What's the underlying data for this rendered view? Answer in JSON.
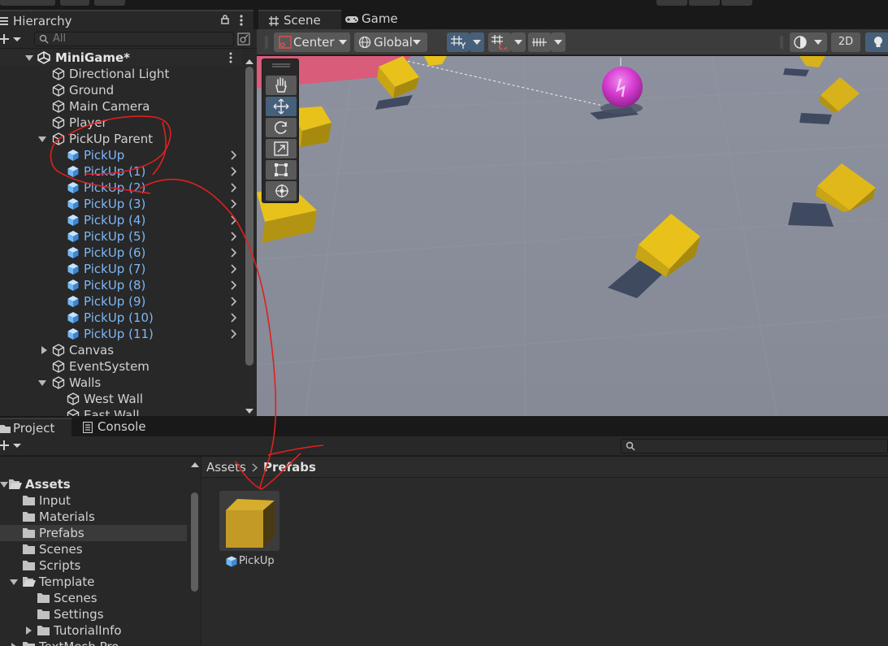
{
  "hierarchy": {
    "tab_label": "Hierarchy",
    "search_placeholder": "All",
    "scene_name": "MiniGame*",
    "items": [
      {
        "label": "Directional Light"
      },
      {
        "label": "Ground"
      },
      {
        "label": "Main Camera"
      },
      {
        "label": "Player"
      },
      {
        "label": "PickUp Parent"
      },
      {
        "label": "PickUp"
      },
      {
        "label": "PickUp (1)"
      },
      {
        "label": "PickUp (2)"
      },
      {
        "label": "PickUp (3)"
      },
      {
        "label": "PickUp (4)"
      },
      {
        "label": "PickUp (5)"
      },
      {
        "label": "PickUp (6)"
      },
      {
        "label": "PickUp (7)"
      },
      {
        "label": "PickUp (8)"
      },
      {
        "label": "PickUp (9)"
      },
      {
        "label": "PickUp (10)"
      },
      {
        "label": "PickUp (11)"
      },
      {
        "label": "Canvas"
      },
      {
        "label": "EventSystem"
      },
      {
        "label": "Walls"
      },
      {
        "label": "West Wall"
      },
      {
        "label": "East Wall"
      }
    ]
  },
  "scene": {
    "scene_tab": "Scene",
    "game_tab": "Game",
    "pivot_label": "Center",
    "space_label": "Global",
    "mode_2d": "2D"
  },
  "project": {
    "project_tab": "Project",
    "console_tab": "Console",
    "tree": [
      {
        "label": "Assets"
      },
      {
        "label": "Input"
      },
      {
        "label": "Materials"
      },
      {
        "label": "Prefabs"
      },
      {
        "label": "Scenes"
      },
      {
        "label": "Scripts"
      },
      {
        "label": "Template"
      },
      {
        "label": "Scenes"
      },
      {
        "label": "Settings"
      },
      {
        "label": "TutorialInfo"
      },
      {
        "label": "TextMesh Pro"
      }
    ],
    "breadcrumb": {
      "root": "Assets",
      "current": "Prefabs"
    },
    "asset": {
      "label": "PickUp"
    }
  },
  "colors": {
    "prefab_text": "#7eb7f5",
    "active_blue": "#46607c",
    "annotation_red": "#e0201e",
    "cube_yellow": "#e8c21b",
    "player_magenta": "#d63bd0"
  }
}
